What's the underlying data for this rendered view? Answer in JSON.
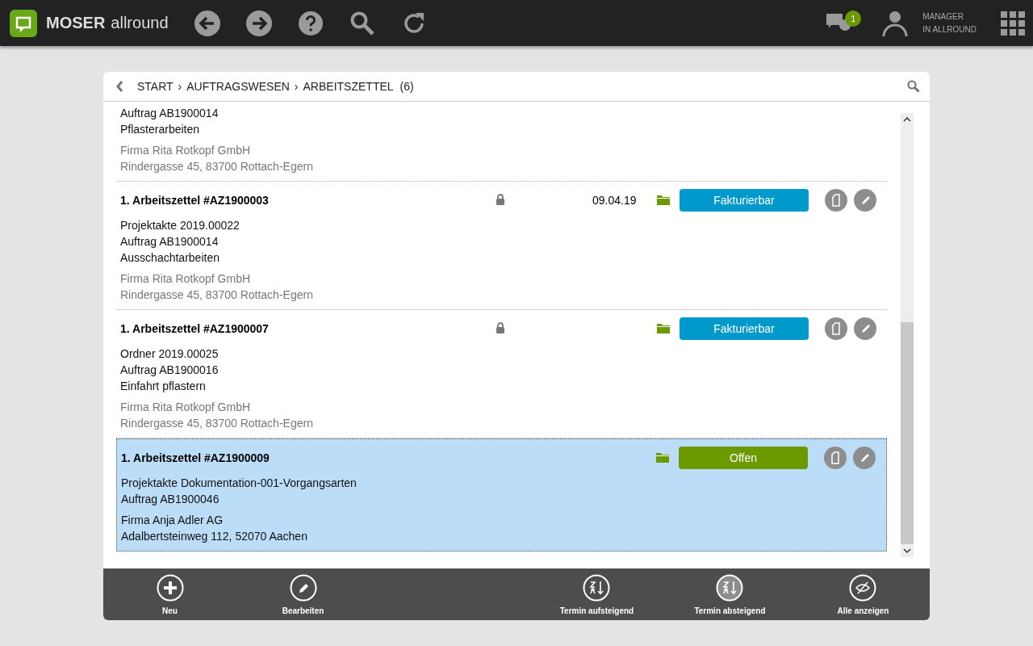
{
  "app": {
    "brand_bold": "MOSER",
    "brand_light": "allround",
    "message_count": "1",
    "user_line1": "MANAGER",
    "user_line2": "IN ALLROUND"
  },
  "breadcrumb": {
    "items": [
      {
        "label": "START"
      },
      {
        "separator": "›",
        "label": "AUFTRAGSWESEN"
      },
      {
        "separator": "›",
        "label": "ARBEITSZETTEL"
      }
    ],
    "count": "(6)"
  },
  "entries": [
    {
      "selected": false,
      "lines": [
        "Auftrag AB1900014",
        "Pflasterarbeiten"
      ],
      "company": "Firma Rita Rotkopf GmbH",
      "address": "Rindergasse 45, 83700 Rottach-Egern"
    },
    {
      "title": "1. Arbeitszettel #AZ1900003",
      "locked": true,
      "date": "09.04.19",
      "status": "Fakturierbar",
      "color": "#0099cc",
      "selected": false,
      "lines": [
        "Projektakte 2019.00022",
        "Auftrag AB1900014",
        "Ausschachtarbeiten"
      ],
      "company": "Firma Rita Rotkopf GmbH",
      "address": "Rindergasse 45, 83700 Rottach-Egern"
    },
    {
      "title": "1. Arbeitszettel #AZ1900007",
      "locked": true,
      "status": "Fakturierbar",
      "color": "#0099cc",
      "selected": false,
      "lines": [
        "Ordner 2019.00025",
        "Auftrag AB1900016",
        "Einfahrt pflastern"
      ],
      "company": "Firma Rita Rotkopf GmbH",
      "address": "Rindergasse 45, 83700 Rottach-Egern"
    },
    {
      "title": "1. Arbeitszettel #AZ1900009",
      "locked": false,
      "status": "Offen",
      "color": "#6a9a00",
      "selected": true,
      "lines": [
        "Projektakte Dokumentation-001-Vorgangsarten",
        "Auftrag AB1900046"
      ],
      "company": "Firma Anja Adler AG",
      "address": "Adalbertsteinweg 112, 52070 Aachen"
    }
  ],
  "footer_left": [
    {
      "kind": "new",
      "label": "Neu",
      "selected": false
    },
    {
      "kind": "edit",
      "label": "Bearbeiten",
      "selected": false
    }
  ],
  "footer_right": [
    {
      "kind": "sort_asc",
      "label": "Termin aufsteigend",
      "selected": false
    },
    {
      "kind": "sort_desc",
      "label": "Termin absteigend",
      "selected": true
    },
    {
      "kind": "show_all",
      "label": "Alle anzeigen",
      "selected": false
    }
  ]
}
